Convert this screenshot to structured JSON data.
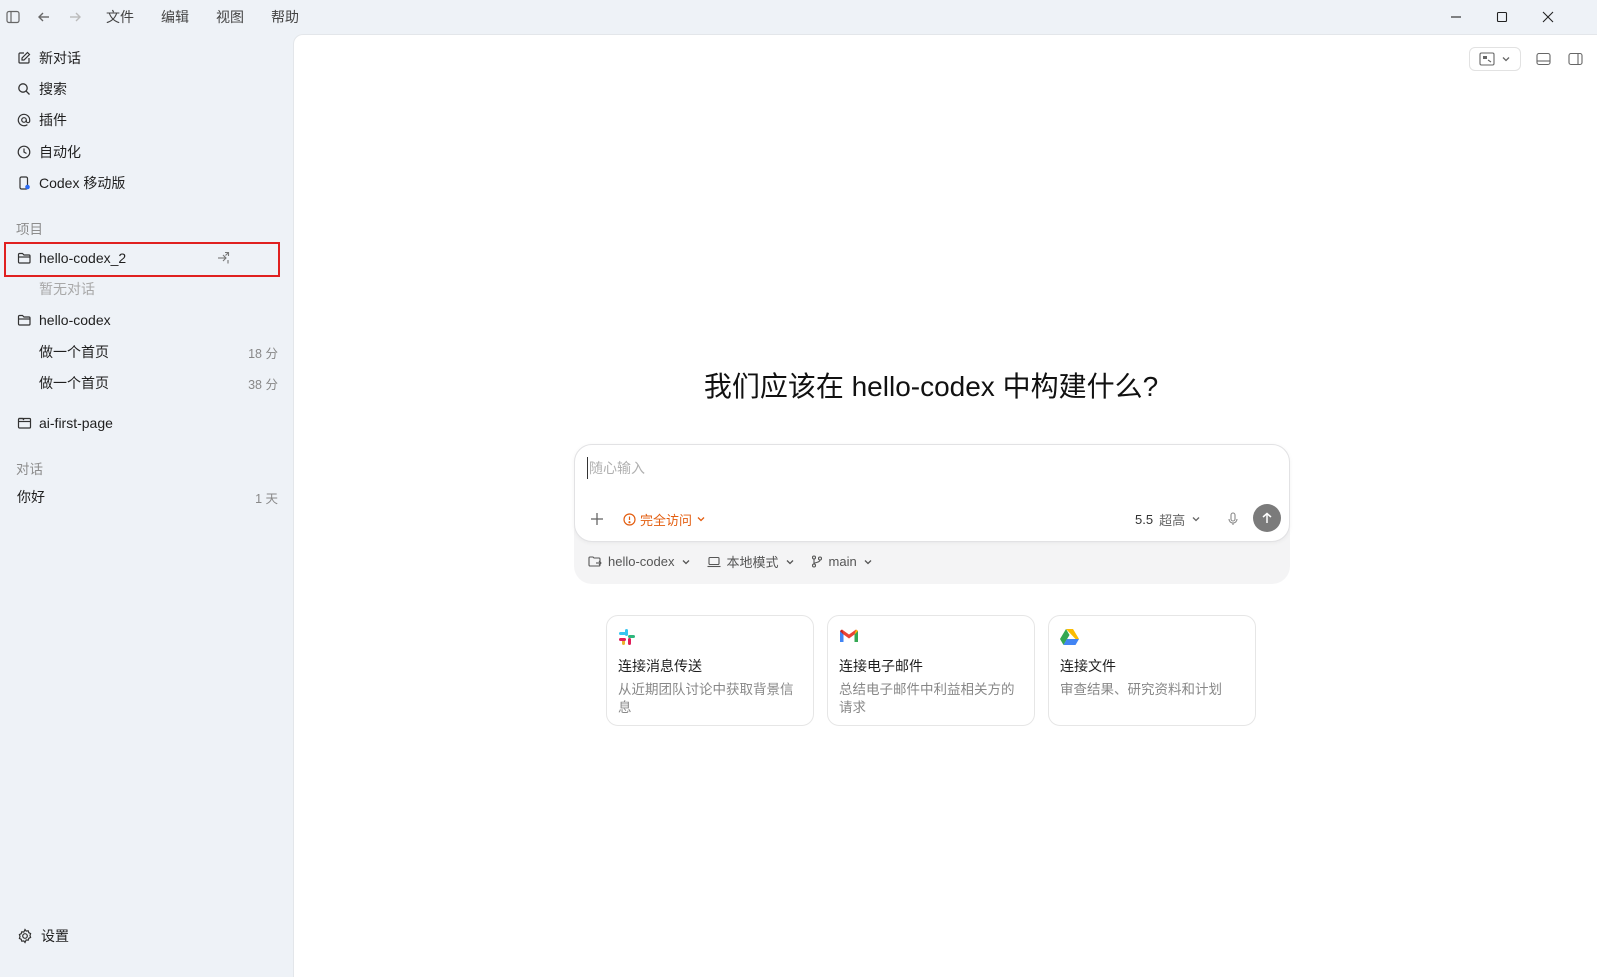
{
  "menubar": {
    "items": [
      "文件",
      "编辑",
      "视图",
      "帮助"
    ]
  },
  "sidebar": {
    "nav": [
      {
        "label": "新对话",
        "icon": "edit-icon"
      },
      {
        "label": "搜索",
        "icon": "search-icon"
      },
      {
        "label": "插件",
        "icon": "at-icon"
      },
      {
        "label": "自动化",
        "icon": "clock-icon"
      },
      {
        "label": "Codex 移动版",
        "icon": "mobile-icon"
      }
    ],
    "projects_label": "项目",
    "projects": [
      {
        "name": "hello-codex_2",
        "empty_text": "暂无对话"
      },
      {
        "name": "hello-codex",
        "threads": [
          {
            "title": "做一个首页",
            "time": "18 分"
          },
          {
            "title": "做一个首页",
            "time": "38 分"
          }
        ]
      },
      {
        "name": "ai-first-page"
      }
    ],
    "chats_label": "对话",
    "chats": [
      {
        "title": "你好",
        "time": "1 天"
      }
    ],
    "settings_label": "设置"
  },
  "main": {
    "headline": "我们应该在 hello-codex 中构建什么?",
    "composer": {
      "placeholder": "随心输入",
      "value": "",
      "access_label": "完全访问",
      "model_version": "5.5",
      "model_level": "超高"
    },
    "footer": {
      "project": "hello-codex",
      "mode": "本地模式",
      "branch": "main"
    },
    "cards": [
      {
        "title": "连接消息传送",
        "desc": "从近期团队讨论中获取背景信息",
        "icon": "slack-logo-icon"
      },
      {
        "title": "连接电子邮件",
        "desc": "总结电子邮件中利益相关方的请求",
        "icon": "gmail-logo-icon"
      },
      {
        "title": "连接文件",
        "desc": "审查结果、研究资料和计划",
        "icon": "google-drive-logo-icon"
      }
    ]
  },
  "colors": {
    "accent_orange": "#e35d0f",
    "highlight_red": "#e02020",
    "sidebar_bg": "#eef2f7"
  }
}
